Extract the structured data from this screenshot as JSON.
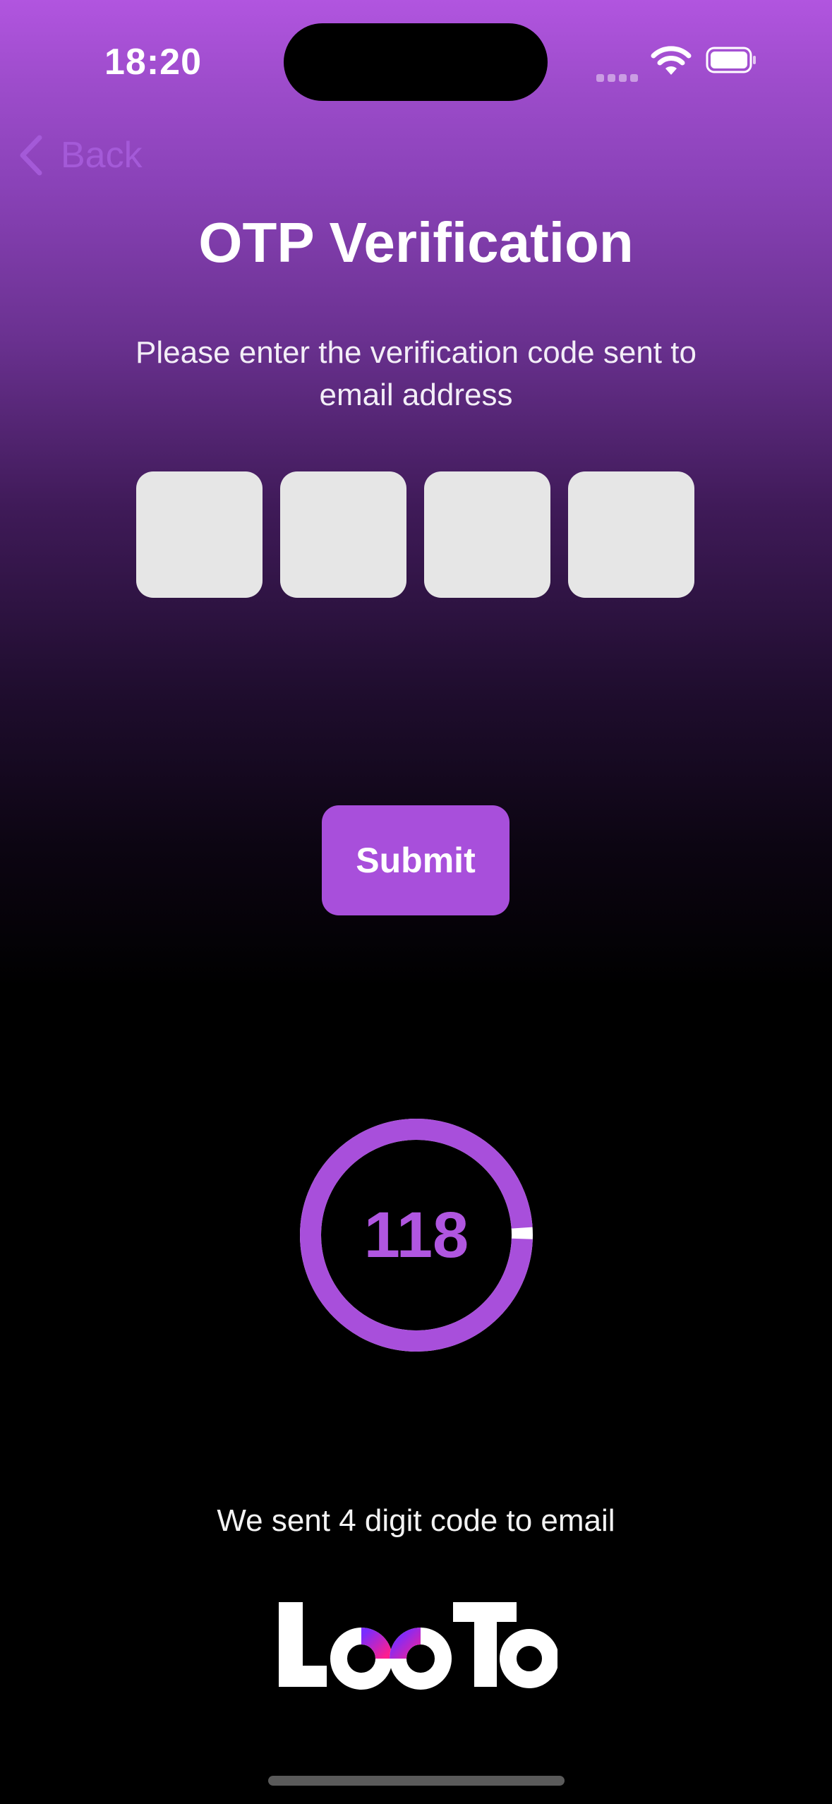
{
  "status_bar": {
    "time": "18:20",
    "icons": [
      "cellular-signal-icon",
      "wifi-icon",
      "battery-icon"
    ]
  },
  "nav": {
    "back_label": "Back"
  },
  "header": {
    "title": "OTP Verification",
    "subtitle": "Please enter the verification code sent to email address"
  },
  "otp": {
    "digits": [
      "",
      "",
      "",
      ""
    ]
  },
  "actions": {
    "submit_label": "Submit"
  },
  "timer": {
    "value": "118",
    "remaining_fraction": 0.983
  },
  "info": {
    "sent_text": "We sent 4 digit code to email"
  },
  "branding": {
    "logo_text": "LooTo"
  },
  "colors": {
    "accent": "#a84fdb",
    "otp_box": "#e6e6e6",
    "back_tint": "#a45ad8"
  }
}
